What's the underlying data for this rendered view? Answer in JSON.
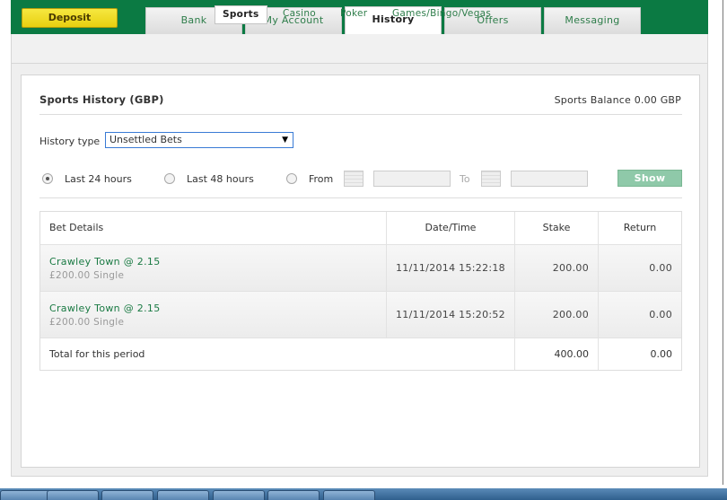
{
  "header": {
    "deposit_label": "Deposit",
    "tabs": [
      {
        "label": "Bank"
      },
      {
        "label": "My Account"
      },
      {
        "label": "History"
      },
      {
        "label": "Offers"
      },
      {
        "label": "Messaging"
      }
    ],
    "active_tab": "History"
  },
  "subnav": {
    "items": [
      {
        "label": "Sports"
      },
      {
        "label": "Casino"
      },
      {
        "label": "Poker"
      },
      {
        "label": "Games/Bingo/Vegas"
      }
    ],
    "active": "Sports"
  },
  "panel": {
    "title": "Sports History (GBP)",
    "balance": "Sports Balance 0.00 GBP",
    "history_type_label": "History type",
    "history_type_value": "Unsettled Bets",
    "filters": {
      "last24": "Last 24 hours",
      "last48": "Last 48 hours",
      "from": "From",
      "to": "To",
      "show_label": "Show",
      "selected": "last24"
    }
  },
  "table": {
    "headers": [
      "Bet Details",
      "Date/Time",
      "Stake",
      "Return"
    ],
    "rows": [
      {
        "selection": "Crawley Town @  2.15",
        "meta": "£200.00  Single",
        "datetime": "11/11/2014 15:22:18",
        "stake": "200.00",
        "return": "0.00"
      },
      {
        "selection": "Crawley Town @  2.15",
        "meta": "£200.00  Single",
        "datetime": "11/11/2014 15:20:52",
        "stake": "200.00",
        "return": "0.00"
      }
    ],
    "total": {
      "label": "Total for this period",
      "stake": "400.00",
      "return": "0.00"
    }
  },
  "colors": {
    "brand_green": "#0b7a43",
    "deposit_yellow": "#f0dc20",
    "show_button": "#8fc9a9"
  }
}
